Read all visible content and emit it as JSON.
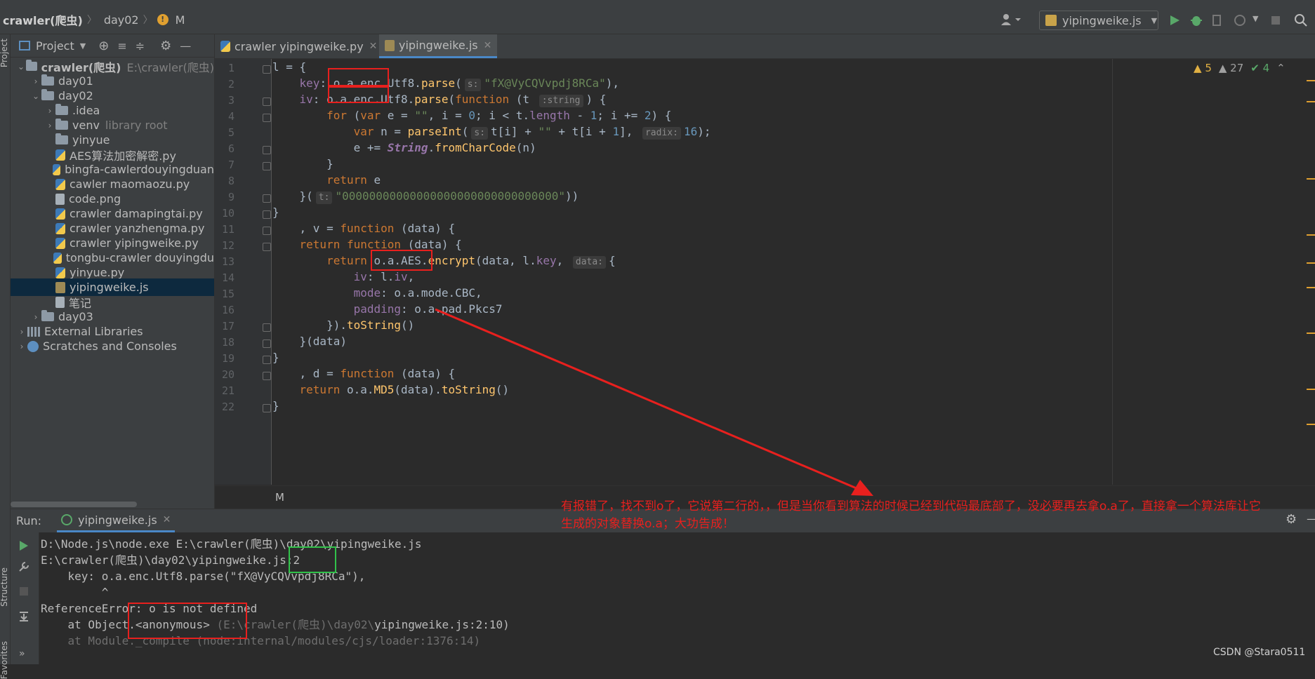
{
  "navbar": {
    "project": "crawler(爬虫)",
    "folder": "day02",
    "vcs_status": "M",
    "run_config": "yipingweike.js"
  },
  "left_strip": {
    "project_label": "Project",
    "structure_label": "Structure",
    "favorites_label": "Favorites"
  },
  "project_panel": {
    "title": "Project",
    "tree": [
      {
        "label": "crawler(爬虫)",
        "hint": "E:\\crawler(爬虫)",
        "type": "folder",
        "depth": 0,
        "expanded": true
      },
      {
        "label": "day01",
        "type": "folder",
        "depth": 1,
        "expanded": false
      },
      {
        "label": "day02",
        "type": "folder",
        "depth": 1,
        "expanded": true
      },
      {
        "label": ".idea",
        "type": "folder",
        "depth": 2,
        "expanded": false
      },
      {
        "label": "venv",
        "hint": "library root",
        "type": "folder",
        "depth": 2,
        "expanded": false
      },
      {
        "label": "yinyue",
        "type": "folder",
        "depth": 2
      },
      {
        "label": "AES算法加密解密.py",
        "type": "py",
        "depth": 2
      },
      {
        "label": "bingfa-cawlerdouyingduan",
        "type": "py",
        "depth": 2
      },
      {
        "label": "cawler maomaozu.py",
        "type": "py",
        "depth": 2
      },
      {
        "label": "code.png",
        "type": "file",
        "depth": 2
      },
      {
        "label": "crawler damapingtai.py",
        "type": "py",
        "depth": 2
      },
      {
        "label": "crawler yanzhengma.py",
        "type": "py",
        "depth": 2
      },
      {
        "label": "crawler yipingweike.py",
        "type": "py",
        "depth": 2
      },
      {
        "label": "tongbu-crawler douyingdu",
        "type": "py",
        "depth": 2
      },
      {
        "label": "yinyue.py",
        "type": "py",
        "depth": 2
      },
      {
        "label": "yipingweike.js",
        "type": "js",
        "depth": 2,
        "selected": true
      },
      {
        "label": "笔记",
        "type": "file",
        "depth": 2
      },
      {
        "label": "day03",
        "type": "folder",
        "depth": 1,
        "expanded": false
      },
      {
        "label": "External Libraries",
        "type": "lib",
        "depth": 0,
        "expanded": false
      },
      {
        "label": "Scratches and Consoles",
        "type": "scratch",
        "depth": 0,
        "expanded": false
      }
    ]
  },
  "editor": {
    "tabs": [
      {
        "label": "crawler yipingweike.py",
        "active": false
      },
      {
        "label": "yipingweike.js",
        "active": true
      }
    ],
    "inspections": {
      "warnings": "5",
      "weak_warnings": "27",
      "ok": "4"
    },
    "line_numbers": [
      "1",
      "2",
      "3",
      "4",
      "5",
      "6",
      "7",
      "8",
      "9",
      "10",
      "11",
      "12",
      "13",
      "14",
      "15",
      "16",
      "17",
      "18",
      "19",
      "20",
      "21",
      "22"
    ],
    "footer_status": "M"
  },
  "run_panel": {
    "label": "Run:",
    "tab": "yipingweike.js",
    "console": [
      "D:\\Node.js\\node.exe E:\\crawler(爬虫)\\day02\\yipingweike.js",
      "E:\\crawler(爬虫)\\day02\\yipingweike.js:2",
      "    key: o.a.enc.Utf8.parse(\"fX@VyCQVvpdj8RCa\"),",
      "         ^",
      "ReferenceError: o is not defined",
      "    at Object.<anonymous> ",
      "(E:\\crawler(爬虫)\\day02\\",
      "yipingweike.js:2:10)",
      "    at Module._compile (node:internal/modules/cjs/loader:1376:14)"
    ]
  },
  "annotation": {
    "line1": "有报错了，找不到o了，它说第二行的，，但是当你看到算法的时候已经到代码最底部了，没必要再去拿o.a了，直接拿一个算法库让它",
    "line2": "生成的对象替换o.a；大功告成！"
  },
  "watermark": "CSDN @Stara0511",
  "colors": {
    "annotation_red": "#e8201e",
    "highlight_green": "#31c24a",
    "selection": "#0d293e",
    "tab_underline": "#4a88c7"
  }
}
